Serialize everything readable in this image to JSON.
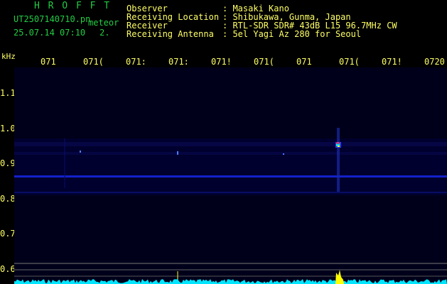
{
  "header": {
    "logo": "H R O F F T",
    "file_name": "UT2507140710.pn",
    "mode": "meteor",
    "datetime": "25.07.14 07:10",
    "count": "2.",
    "info_labels": [
      "Observer",
      "Receiving Location",
      "Receiver",
      "Receiving Antenna"
    ],
    "info_values": [
      ": Masaki Kano",
      ": Shibukawa, Gunma, Japan",
      ": RTL-SDR SDR# 43dB L15 96.7MHz CW",
      ": 5el Yagi Az 280 for Seoul"
    ]
  },
  "axis": {
    "unit": "kHz",
    "y_ticks": [
      "1.1",
      "1.0",
      "0.9",
      "0.8",
      "0.7",
      "0.6"
    ],
    "time_ticks": [
      "071",
      "071(",
      "071:",
      "071:",
      "071!",
      "071(",
      "071",
      "071(",
      "071!",
      "0720"
    ]
  },
  "colors": {
    "background": "#000000",
    "plot_bg": "#00001a",
    "label_green": "#22cc44",
    "label_yellow": "#ffff66",
    "trace_cyan": "#00ffff",
    "echo_yellow": "#ffff00"
  }
}
